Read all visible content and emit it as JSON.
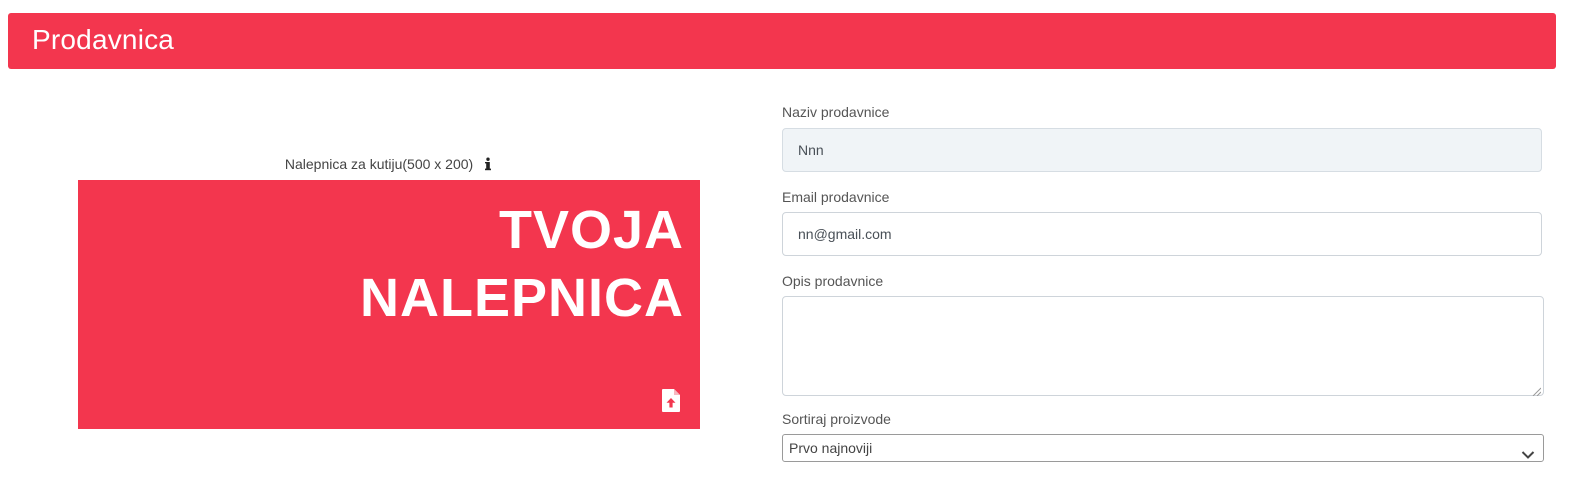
{
  "header": {
    "title": "Prodavnica"
  },
  "sticker": {
    "label": "Nalepnica za kutiju(500 x 200)",
    "line1": "TVOJA",
    "line2": "NALEPNICA",
    "info_icon": "info-icon",
    "upload_icon": "file-upload-icon"
  },
  "form": {
    "name_label": "Naziv prodavnice",
    "name_value": "Nnn",
    "email_label": "Email prodavnice",
    "email_value": "nn@gmail.com",
    "description_label": "Opis prodavnice",
    "description_value": "",
    "sort_label": "Sortiraj proizvode",
    "sort_selected": "Prvo najnoviji"
  },
  "colors": {
    "brand": "#f3364e",
    "readonly_bg": "#f0f4f7"
  }
}
